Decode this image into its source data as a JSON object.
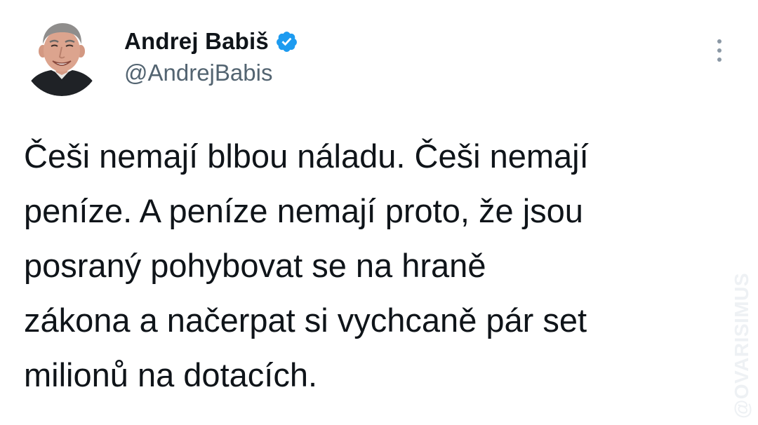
{
  "tweet": {
    "author": {
      "display_name": "Andrej Babiš",
      "handle": "@AndrejBabis",
      "verified": true,
      "verified_badge_color": "#1d9bf0",
      "avatar_icon": "profile-photo"
    },
    "menu_icon": "more-vertical-icon",
    "text_lines": [
      "Češi nemají blbou náladu. Češi nemají",
      "peníze. A peníze nemají proto, že jsou",
      "posraný pohybovat se na hraně",
      "zákona a načerpat si vychcaně pár set",
      "milionů na dotacích."
    ]
  },
  "watermark": {
    "text": "@OVARISIMUS"
  },
  "colors": {
    "text_primary": "#0f1419",
    "text_secondary": "#536471",
    "background": "#ffffff",
    "watermark": "#eef1f4"
  }
}
